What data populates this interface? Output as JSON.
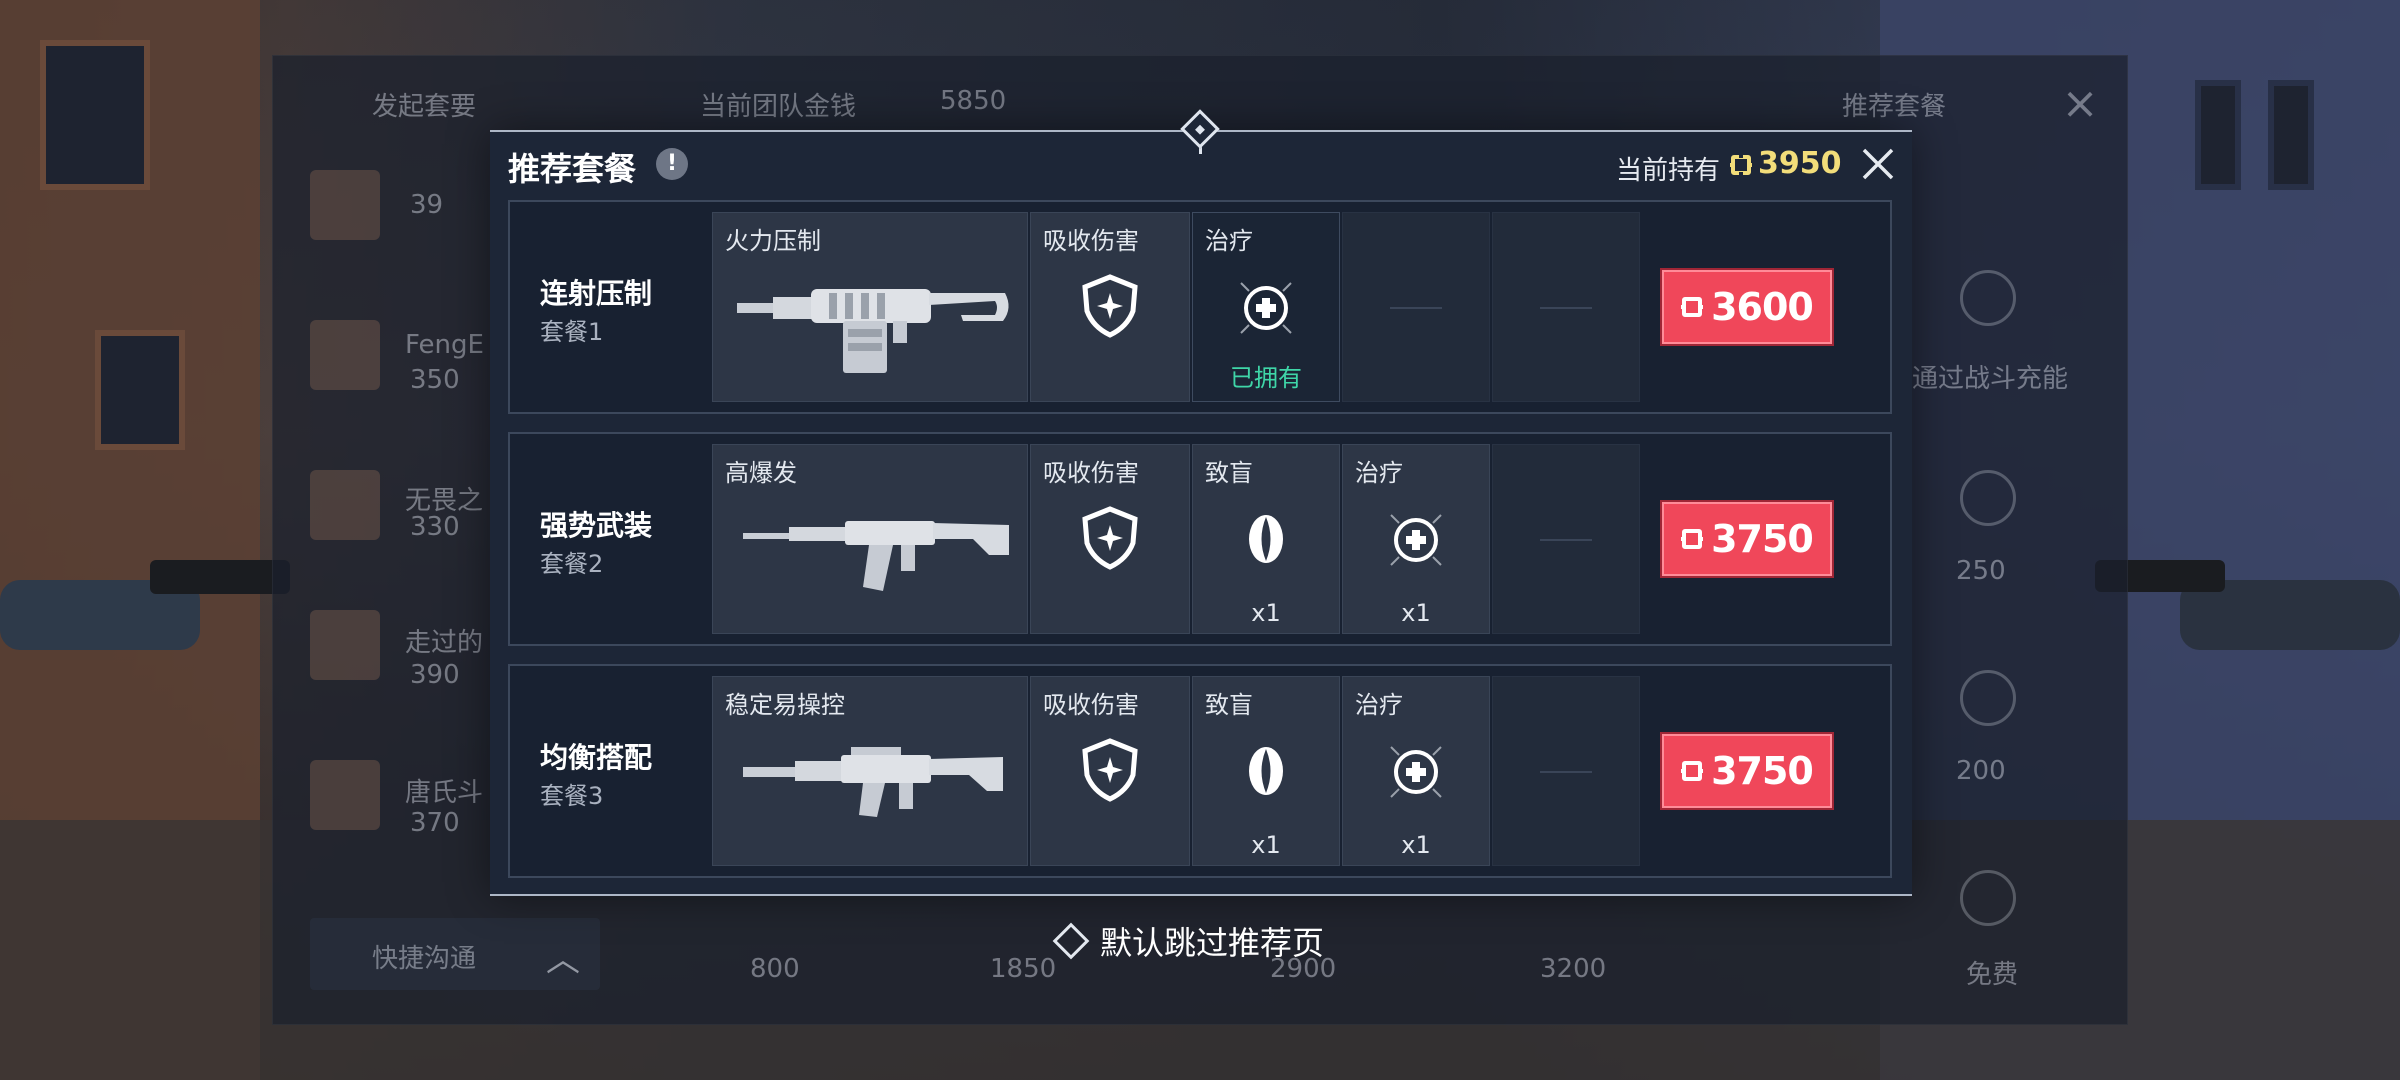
{
  "background_shop": {
    "header_left": "发起套要",
    "header_mid": "当前团队金钱",
    "header_mid_value": "5850",
    "header_right": "推荐套餐",
    "player_credits": [
      "39",
      "350",
      "330",
      "390",
      "370"
    ],
    "player_names": [
      "FengE",
      "无畏之",
      "走过的",
      "唐氏斗"
    ],
    "quick_chat": "快捷沟通",
    "bottom_prices": [
      "800",
      "1850",
      "2900",
      "3200"
    ],
    "right_items": [
      "通过战斗充能",
      "250",
      "200",
      "免费"
    ]
  },
  "modal": {
    "title": "推荐套餐",
    "balance_label": "当前持有",
    "balance_value": "3950",
    "packages": [
      {
        "name": "连射压制",
        "subtitle": "套餐1",
        "weapon_label": "火力压制",
        "slots": [
          {
            "label": "吸收伤害",
            "icon": "shield-icon"
          },
          {
            "label": "治疗",
            "icon": "heal-icon",
            "status": "已拥有"
          }
        ],
        "price": "3600"
      },
      {
        "name": "强势武装",
        "subtitle": "套餐2",
        "weapon_label": "高爆发",
        "slots": [
          {
            "label": "吸收伤害",
            "icon": "shield-icon"
          },
          {
            "label": "致盲",
            "icon": "blind-icon",
            "count": "x1"
          },
          {
            "label": "治疗",
            "icon": "heal-icon",
            "count": "x1"
          }
        ],
        "price": "3750"
      },
      {
        "name": "均衡搭配",
        "subtitle": "套餐3",
        "weapon_label": "稳定易操控",
        "slots": [
          {
            "label": "吸收伤害",
            "icon": "shield-icon"
          },
          {
            "label": "致盲",
            "icon": "blind-icon",
            "count": "x1"
          },
          {
            "label": "治疗",
            "icon": "heal-icon",
            "count": "x1"
          }
        ],
        "price": "3750"
      }
    ],
    "skip_label": "默认跳过推荐页"
  },
  "colors": {
    "buy_button": "#f0475a",
    "balance": "#f2dd7a",
    "owned": "#3fd6a8",
    "modal_bg": "#1d2637"
  }
}
